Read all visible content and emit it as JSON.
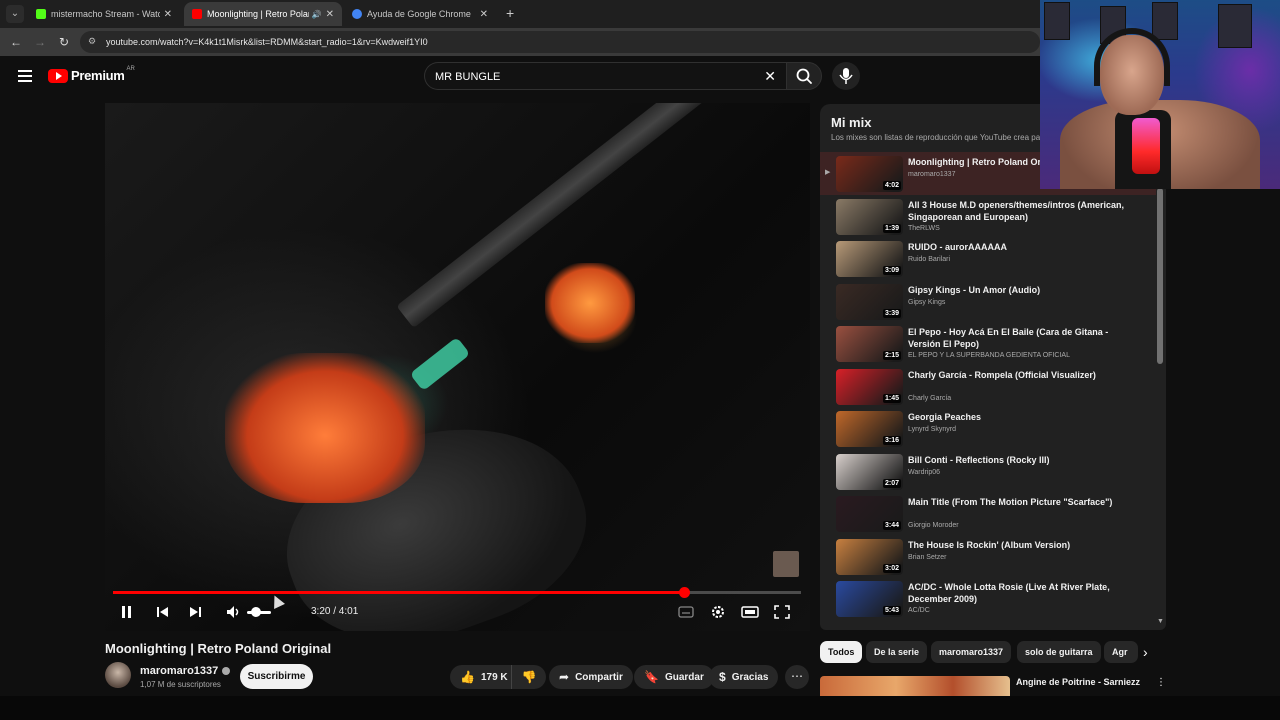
{
  "browser": {
    "tabs": [
      {
        "title": "mistermacho Stream - Watch Li",
        "favicon_color": "#53fc18",
        "active": false
      },
      {
        "title": "Moonlighting | Retro Polan",
        "favicon_color": "#ff0000",
        "active": true
      },
      {
        "title": "Ayuda de Google Chrome",
        "favicon_color": "#4285f4",
        "active": false
      }
    ],
    "url": "youtube.com/watch?v=K4k1t1Misrk&list=RDMM&start_radio=1&rv=Kwdweif1YI0"
  },
  "header": {
    "logo_text": "Premium",
    "country": "AR",
    "search_query": "MR BUNGLE"
  },
  "player": {
    "time_display": "3:20 / 4:01",
    "progress_fraction": 0.83,
    "accent_color": "#ff0000"
  },
  "video": {
    "title": "Moonlighting | Retro Poland Original",
    "channel": "maromaro1337",
    "subscribers": "1,07 M de suscriptores",
    "subscribe_label": "Suscribirme",
    "likes": "179 K",
    "share_label": "Compartir",
    "save_label": "Guardar",
    "thanks_label": "Gracias"
  },
  "playlist": {
    "title": "Mi mix",
    "subtitle": "Los mixes son listas de reproducción que YouTube crea pa",
    "items": [
      {
        "title": "Moonlighting | Retro Poland Ori",
        "author": "maromaro1337",
        "duration": "4:02",
        "active": true,
        "thumb": "#7a2a1a"
      },
      {
        "title": "All 3 House M.D openers/themes/intros (American, Singaporean and European)",
        "author": "TheRLWS",
        "duration": "1:39",
        "active": false,
        "thumb": "#8a7a66"
      },
      {
        "title": "RUIDO - aurorAAAAAA",
        "author": "Ruido Barilari",
        "duration": "3:09",
        "active": false,
        "thumb": "#b89a78"
      },
      {
        "title": "Gipsy Kings - Un Amor (Audio)",
        "author": "Gipsy Kings",
        "duration": "3:39",
        "active": false,
        "thumb": "#3a2a24"
      },
      {
        "title": "El Pepo - Hoy Acá En El Baile (Cara de Gitana - Versión El Pepo)",
        "author": "EL PEPO Y LA SUPERBANDA GEDIENTA OFICIAL",
        "duration": "2:15",
        "active": false,
        "thumb": "#9a5040"
      },
      {
        "title": "Charly García - Rompela (Official Visualizer)",
        "author": "Charly García",
        "duration": "1:45",
        "active": false,
        "thumb": "#d82028"
      },
      {
        "title": "Georgia Peaches",
        "author": "Lynyrd Skynyrd",
        "duration": "3:16",
        "active": false,
        "thumb": "#c0682a"
      },
      {
        "title": "Bill Conti - Reflections (Rocky III)",
        "author": "Wardrip06",
        "duration": "2:07",
        "active": false,
        "thumb": "#d8d0cc"
      },
      {
        "title": "Main Title (From The Motion Picture \"Scarface\")",
        "author": "Giorgio Moroder",
        "duration": "3:44",
        "active": false,
        "thumb": "#2a1a20"
      },
      {
        "title": "The House Is Rockin' (Album Version)",
        "author": "Brian Setzer",
        "duration": "3:02",
        "active": false,
        "thumb": "#c88040"
      },
      {
        "title": "AC/DC - Whole Lotta Rosie (Live At River Plate, December 2009)",
        "author": "AC/DC",
        "duration": "5:43",
        "active": false,
        "thumb": "#2a4aa0"
      }
    ]
  },
  "chips": [
    "Todos",
    "De la serie",
    "maromaro1337",
    "solo de guitarra",
    "Agr"
  ],
  "recommended": {
    "title": "Angine de Poitrine - Sarniezz"
  }
}
